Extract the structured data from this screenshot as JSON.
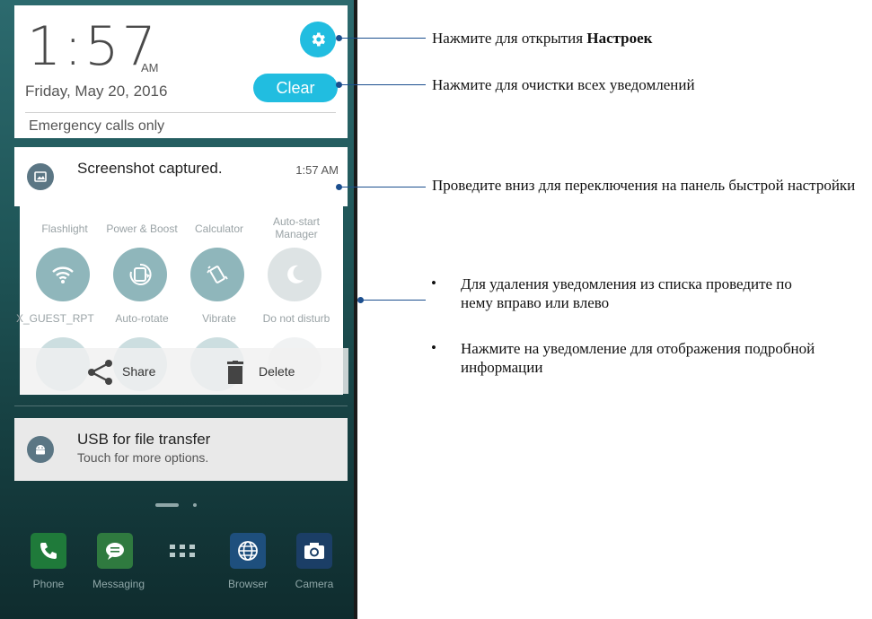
{
  "status_panel": {
    "clock_time": "1:57",
    "clock_ampm": "AM",
    "date": "Friday, May 20, 2016",
    "clear_label": "Clear",
    "emergency": "Emergency calls only"
  },
  "notifications": [
    {
      "title": "Screenshot captured.",
      "time": "1:57 AM",
      "icon": "image-icon"
    },
    {
      "title": "USB for file transfer",
      "subtitle": "Touch for more options.",
      "icon": "android-icon"
    }
  ],
  "quick_settings": {
    "row_top_labels": [
      "Flashlight",
      "Power & Boost",
      "Calculator",
      "Auto-start Manager"
    ],
    "tiles": [
      {
        "label": "X_GUEST_RPT",
        "icon": "wifi-icon",
        "active": true
      },
      {
        "label": "Auto-rotate",
        "icon": "auto-rotate-icon",
        "active": true
      },
      {
        "label": "Vibrate",
        "icon": "vibrate-icon",
        "active": true
      },
      {
        "label": "Do not disturb",
        "icon": "moon-icon",
        "active": false
      }
    ]
  },
  "notification_actions": {
    "share_label": "Share",
    "delete_label": "Delete"
  },
  "dock": [
    {
      "label": "Phone",
      "icon": "phone-icon",
      "color": "#1f7a3a"
    },
    {
      "label": "Messaging",
      "icon": "message-icon",
      "color": "#2f7a3f"
    },
    {
      "label": "",
      "icon": "all-apps-icon",
      "color": ""
    },
    {
      "label": "Browser",
      "icon": "globe-icon",
      "color": "#1e4f7d"
    },
    {
      "label": "Camera",
      "icon": "camera-icon",
      "color": "#1b3e66"
    }
  ],
  "callouts": {
    "settings_prefix": "Нажмите для открытия ",
    "settings_bold": "Настроек",
    "clear": "Нажмите для очистки всех уведомлений",
    "swipe_down": "Проведите вниз для переключения на панель быстрой настройки",
    "bullet1": "Для удаления уведомления из списка проведите по нему вправо или влево",
    "bullet2": "Нажмите на уведомление для отображения подробной информации"
  },
  "colors": {
    "accent": "#21bde0",
    "callout_line": "#1b4e8e",
    "tile_active": "#8fb6bb"
  }
}
